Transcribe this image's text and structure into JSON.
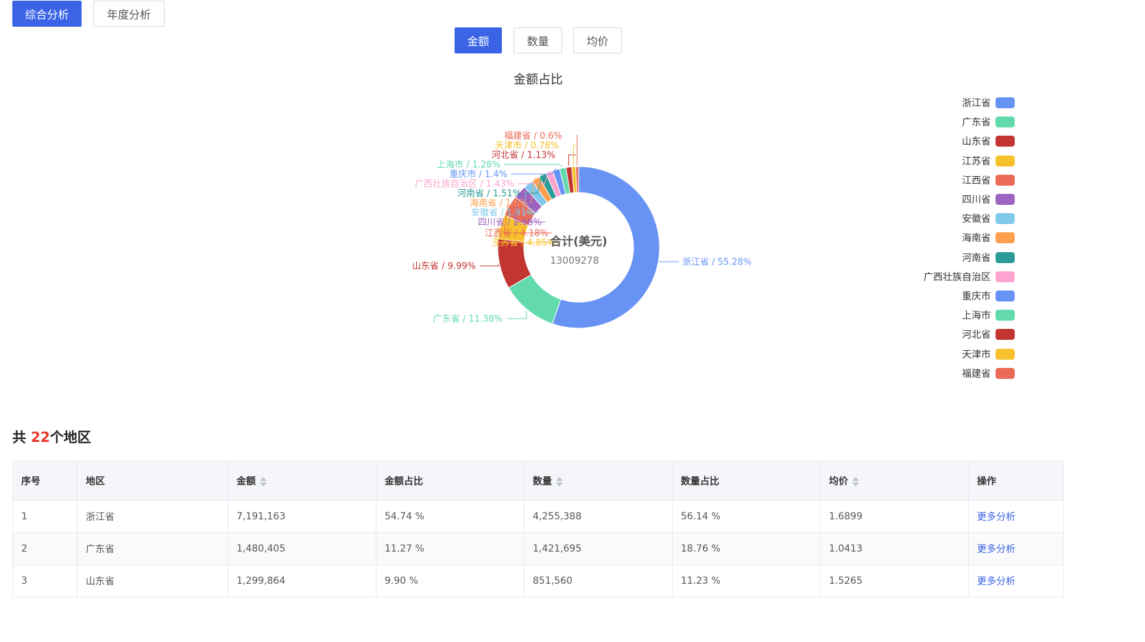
{
  "tabs": {
    "comprehensive": "综合分析",
    "annual": "年度分析"
  },
  "metric_tabs": {
    "amount": "金额",
    "quantity": "数量",
    "avg_price": "均价"
  },
  "chart_data": {
    "type": "pie",
    "title": "金额占比",
    "center_label": "合计(美元)",
    "center_value": "13009278",
    "slices": [
      {
        "name": "浙江省",
        "pct": 55.28,
        "label": "浙江省 / 55.28%",
        "color": "#6794f4"
      },
      {
        "name": "广东省",
        "pct": 11.38,
        "label": "广东省 / 11.38%",
        "color": "#62daab"
      },
      {
        "name": "山东省",
        "pct": 9.99,
        "label": "山东省 / 9.99%",
        "color": "#c23531"
      },
      {
        "name": "江苏省",
        "pct": 4.85,
        "label": "江苏省 / 4.85%",
        "color": "#f7c12d"
      },
      {
        "name": "江西省",
        "pct": 4.18,
        "label": "江西省 / 4.18%",
        "color": "#ea6b58"
      },
      {
        "name": "四川省",
        "pct": 2.68,
        "label": "四川省 / 2.68%",
        "color": "#9c63c1"
      },
      {
        "name": "安徽省",
        "pct": 1.91,
        "label": "安徽省 / 1.91%",
        "color": "#7fc9ec"
      },
      {
        "name": "海南省",
        "pct": 1.6,
        "label": "海南省 / 1.6%",
        "color": "#ff9f4f"
      },
      {
        "name": "河南省",
        "pct": 1.51,
        "label": "河南省 / 1.51%",
        "color": "#2a9b96"
      },
      {
        "name": "广西壮族自治区",
        "pct": 1.43,
        "label": "广西壮族自治区 / 1.43%",
        "color": "#fca4cf"
      },
      {
        "name": "重庆市",
        "pct": 1.4,
        "label": "重庆市 / 1.4%",
        "color": "#6794f4"
      },
      {
        "name": "上海市",
        "pct": 1.28,
        "label": "上海市 / 1.28%",
        "color": "#62daab"
      },
      {
        "name": "河北省",
        "pct": 1.13,
        "label": "河北省 / 1.13%",
        "color": "#c23531"
      },
      {
        "name": "天津市",
        "pct": 0.78,
        "label": "天津市 / 0.78%",
        "color": "#f7c12d"
      },
      {
        "name": "福建省",
        "pct": 0.6,
        "label": "福建省 / 0.6%",
        "color": "#ea6b58"
      }
    ]
  },
  "legend": [
    "浙江省",
    "广东省",
    "山东省",
    "江苏省",
    "江西省",
    "四川省",
    "安徽省",
    "海南省",
    "河南省",
    "广西壮族自治区",
    "重庆市",
    "上海市",
    "河北省",
    "天津市",
    "福建省"
  ],
  "summary": {
    "prefix": "共 ",
    "count": "22",
    "suffix": "个地区"
  },
  "table": {
    "headers": [
      "序号",
      "地区",
      "金额",
      "金额占比",
      "数量",
      "数量占比",
      "均价",
      "操作"
    ],
    "rows": [
      [
        "1",
        "浙江省",
        "7,191,163",
        "54.74 %",
        "4,255,388",
        "56.14 %",
        "1.6899",
        "更多分析"
      ],
      [
        "2",
        "广东省",
        "1,480,405",
        "11.27 %",
        "1,421,695",
        "18.76 %",
        "1.0413",
        "更多分析"
      ],
      [
        "3",
        "山东省",
        "1,299,864",
        "9.90 %",
        "851,560",
        "11.23 %",
        "1.5265",
        "更多分析"
      ]
    ]
  }
}
